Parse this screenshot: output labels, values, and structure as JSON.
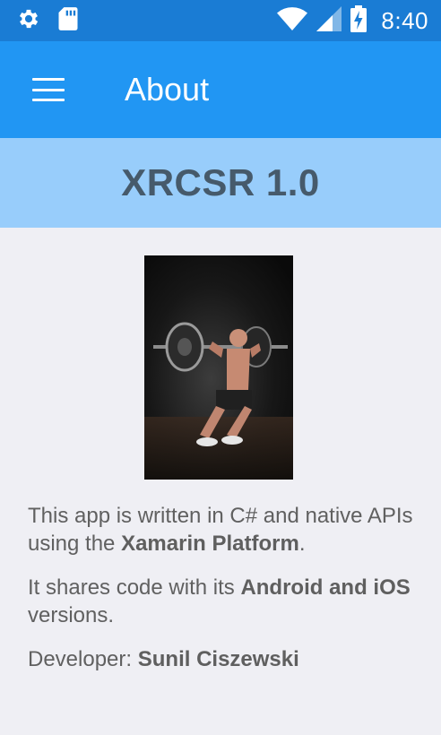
{
  "status_bar": {
    "time": "8:40",
    "icons": [
      "settings-icon",
      "sd-card-icon",
      "wifi-icon",
      "signal-icon",
      "battery-charging-icon"
    ],
    "color": "#1a7cd4"
  },
  "app_bar": {
    "title": "About",
    "menu_icon": "hamburger-menu-icon",
    "color": "#2196f3"
  },
  "banner": {
    "title": "XRCSR 1.0",
    "color": "#98cdfb"
  },
  "hero_image": {
    "description_icon": "weightlifter-photo"
  },
  "content": {
    "p1_prefix": "This app is written in C# and native APIs using the ",
    "p1_bold": "Xamarin Platform",
    "p1_suffix": ".",
    "p2_prefix": "It shares code with its ",
    "p2_bold": "Android and iOS",
    "p2_suffix": " versions.",
    "p3_prefix": "Developer: ",
    "p3_bold": "Sunil Ciszewski"
  }
}
